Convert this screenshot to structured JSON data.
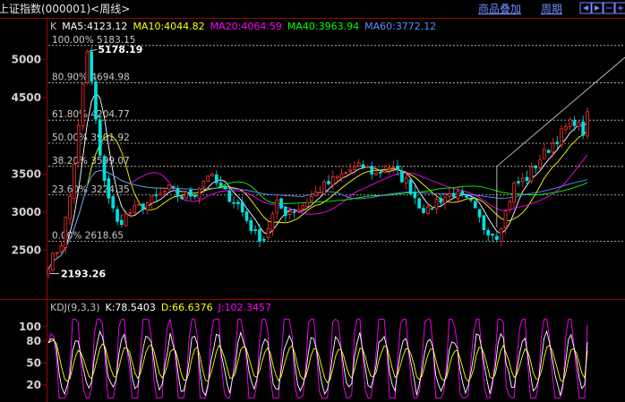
{
  "header": {
    "title": "上证指数(000001)<周线>",
    "btn_overlay": "商品叠加",
    "btn_period": "周期",
    "nav_icons": [
      "left-arrow-icon",
      "right-arrow-icon",
      "zoom-out-icon",
      "zoom-in-icon"
    ]
  },
  "colors": {
    "ma5": "#ffffff",
    "ma10": "#ffff00",
    "ma20": "#ff00ff",
    "ma40": "#00ff00",
    "ma60": "#5b8cff",
    "k": "#ffffff",
    "d": "#ffff00",
    "j": "#ff00ff",
    "up": "#ff3030",
    "down": "#00e0e0",
    "grid": "#a00000",
    "axis": "#a00000"
  },
  "chart_data": [
    {
      "type": "candlestick",
      "legend": [
        {
          "label": "K",
          "color": "#c0c0c0"
        },
        {
          "label": "MA5:4123.12",
          "color": "#ffffff"
        },
        {
          "label": "MA10:4044.82",
          "color": "#ffff00"
        },
        {
          "label": "MA20:4064.59",
          "color": "#ff00ff"
        },
        {
          "label": "MA40:3963.94",
          "color": "#00ff00"
        },
        {
          "label": "MA60:3772.12",
          "color": "#5b8cff"
        }
      ],
      "y_ticks": [
        2500,
        3000,
        3500,
        4500,
        5000
      ],
      "ylim": [
        2060,
        5310
      ],
      "fib_levels": [
        {
          "label": "100.00% 5183.15",
          "value": 5183.15
        },
        {
          "label": "80.90% 4694.98",
          "value": 4694.98
        },
        {
          "label": "61.80% 4204.77",
          "value": 4204.77
        },
        {
          "label": "50.00% 3901.92",
          "value": 3901.92
        },
        {
          "label": "38.20% 3599.07",
          "value": 3599.07
        },
        {
          "label": "23.60% 3224.35",
          "value": 3224.35
        },
        {
          "label": "0.00% 2618.65",
          "value": 2618.65
        }
      ],
      "annotations": [
        {
          "label": "5178.19",
          "value": 5178.19
        },
        {
          "label": "2193.26",
          "value": 2193.26
        }
      ],
      "price_path": [
        [
          0,
          2300
        ],
        [
          3,
          2600
        ],
        [
          5,
          3200
        ],
        [
          7,
          4100
        ],
        [
          9,
          5178
        ],
        [
          11,
          4200
        ],
        [
          12,
          3700
        ],
        [
          14,
          3200
        ],
        [
          16,
          2850
        ],
        [
          19,
          3000
        ],
        [
          24,
          3150
        ],
        [
          28,
          3300
        ],
        [
          31,
          3200
        ],
        [
          34,
          3250
        ],
        [
          37,
          3500
        ],
        [
          41,
          3250
        ],
        [
          44,
          3100
        ],
        [
          48,
          2700
        ],
        [
          50,
          2660
        ],
        [
          53,
          3100
        ],
        [
          55,
          3000
        ],
        [
          58,
          3050
        ],
        [
          63,
          3300
        ],
        [
          67,
          3450
        ],
        [
          70,
          3550
        ],
        [
          73,
          3600
        ],
        [
          76,
          3500
        ],
        [
          79,
          3600
        ],
        [
          83,
          3400
        ],
        [
          86,
          3100
        ],
        [
          88,
          3000
        ],
        [
          90,
          3150
        ],
        [
          94,
          3250
        ],
        [
          98,
          3100
        ],
        [
          101,
          2800
        ],
        [
          104,
          2700
        ],
        [
          106,
          3000
        ],
        [
          108,
          3350
        ],
        [
          111,
          3450
        ],
        [
          114,
          3700
        ],
        [
          117,
          3900
        ],
        [
          120,
          4100
        ],
        [
          122,
          4200
        ],
        [
          124,
          4050
        ],
        [
          125,
          4250
        ]
      ],
      "xrange": [
        0,
        125
      ]
    },
    {
      "type": "line",
      "legend": [
        {
          "label": "KDJ(9,3,3)",
          "color": "#c0c0c0"
        },
        {
          "label": "K:78.5403",
          "color": "#ffffff"
        },
        {
          "label": "D:66.6376",
          "color": "#ffff00"
        },
        {
          "label": "J:102.3457",
          "color": "#ff00ff"
        }
      ],
      "y_ticks": [
        20,
        50,
        80,
        100
      ],
      "ylim": [
        0,
        112
      ]
    }
  ]
}
